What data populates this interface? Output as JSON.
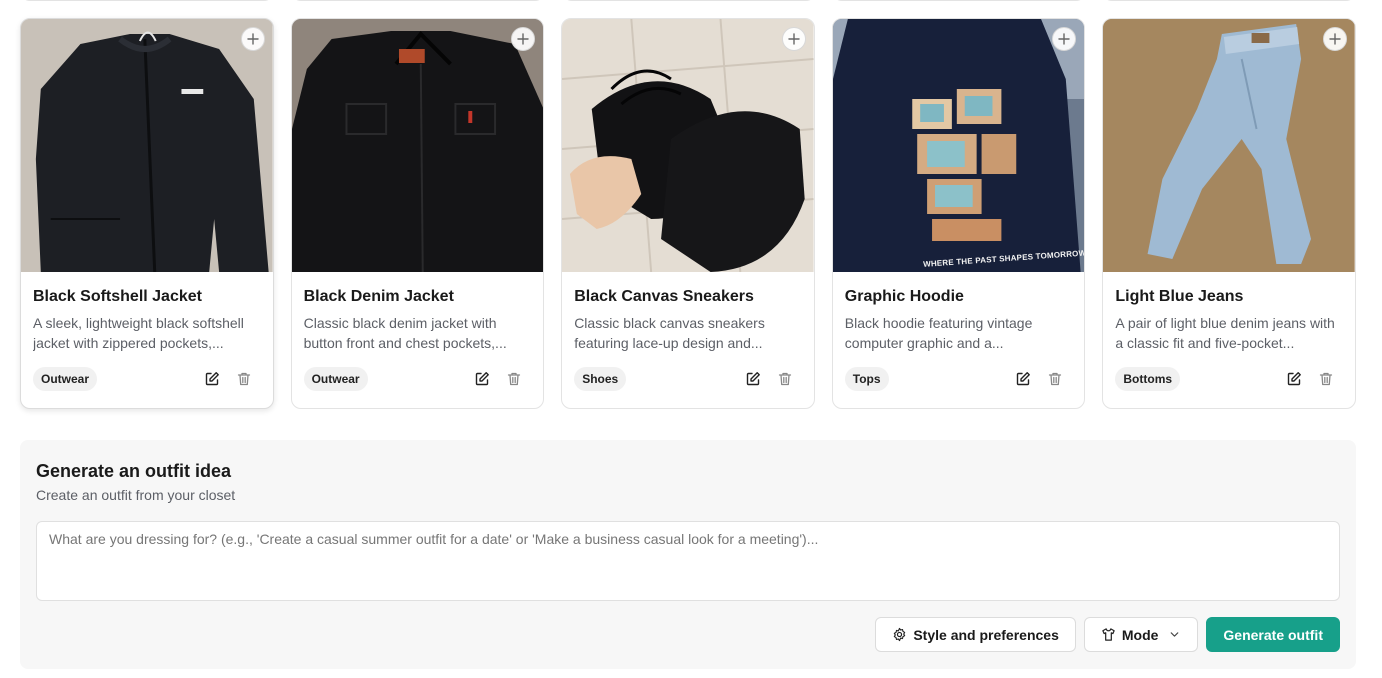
{
  "cards": [
    {
      "title": "Black Softshell Jacket",
      "description": "A sleek, lightweight black softshell jacket with zippered pockets,...",
      "category": "Outwear"
    },
    {
      "title": "Black Denim Jacket",
      "description": "Classic black denim jacket with button front and chest pockets,...",
      "category": "Outwear"
    },
    {
      "title": "Black Canvas Sneakers",
      "description": "Classic black canvas sneakers featuring lace-up design and...",
      "category": "Shoes"
    },
    {
      "title": "Graphic Hoodie",
      "description": "Black hoodie featuring vintage computer graphic and a...",
      "category": "Tops"
    },
    {
      "title": "Light Blue Jeans",
      "description": "A pair of light blue denim jeans with a classic fit and five-pocket...",
      "category": "Bottoms"
    }
  ],
  "hoodie_print_text": "WHERE THE PAST SHAPES TOMORROW",
  "generator": {
    "title": "Generate an outfit idea",
    "subtitle": "Create an outfit from your closet",
    "placeholder": "What are you dressing for? (e.g., 'Create a casual summer outfit for a date' or 'Make a business casual look for a meeting')...",
    "style_button": "Style and preferences",
    "mode_button": "Mode",
    "generate_button": "Generate outfit"
  },
  "colors": {
    "accent": "#17a08a",
    "badge_bg": "#f1f1f1",
    "panel_bg": "#f7f7f7"
  },
  "icons": {
    "add": "plus-icon",
    "edit": "edit-icon",
    "delete": "trash-icon",
    "style": "gear-icon",
    "mode": "shirt-icon",
    "dropdown": "chevron-down-icon"
  }
}
